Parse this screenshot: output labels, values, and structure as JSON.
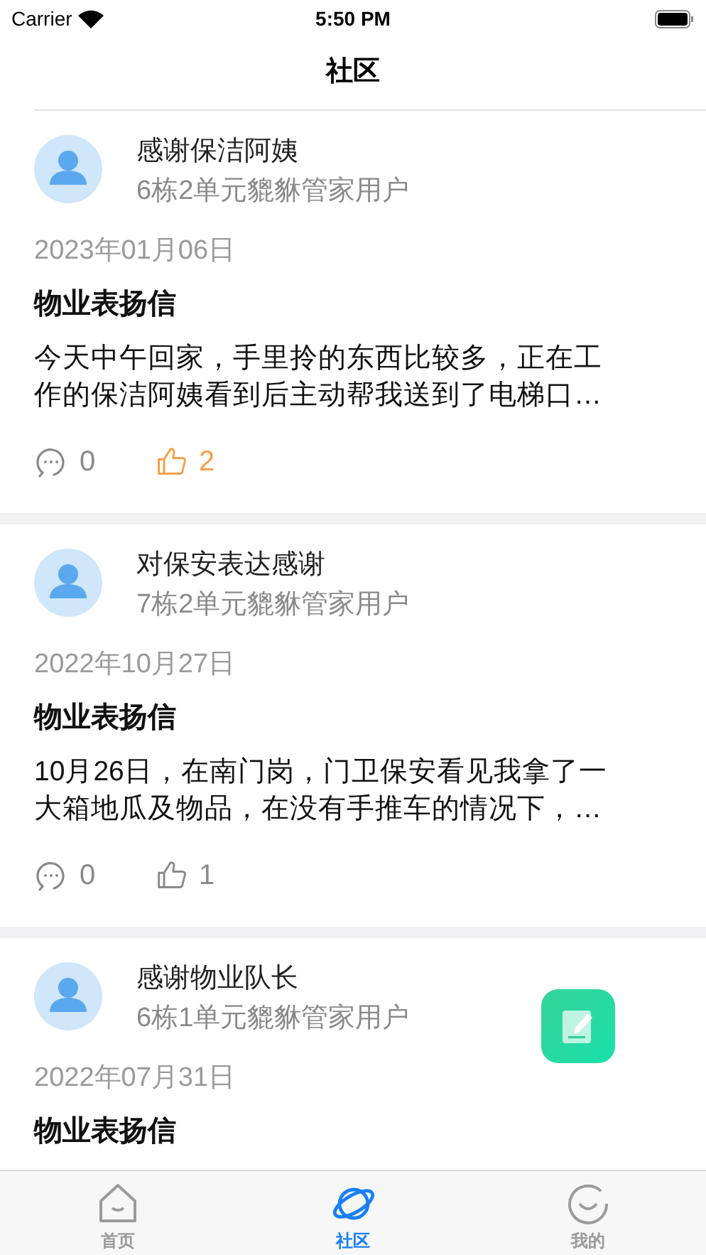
{
  "status_bar": {
    "carrier": "Carrier",
    "time": "5:50 PM"
  },
  "nav": {
    "title": "社区"
  },
  "posts": [
    {
      "title": "感谢保洁阿姨",
      "author": "6栋2单元貔貅管家用户",
      "date": "2023年01月06日",
      "category": "物业表扬信",
      "body": "今天中午回家，手里拎的东西比较多，正在工作的保洁阿姨看到后主动帮我送到了电梯口…",
      "comments": "0",
      "likes": "2",
      "liked": true
    },
    {
      "title": "对保安表达感谢",
      "author": "7栋2单元貔貅管家用户",
      "date": "2022年10月27日",
      "category": "物业表扬信",
      "body": "10月26日，在南门岗，门卫保安看见我拿了一大箱地瓜及物品，在没有手推车的情况下，…",
      "comments": "0",
      "likes": "1",
      "liked": false
    },
    {
      "title": "感谢物业队长",
      "author": "6栋1单元貔貅管家用户",
      "date": "2022年07月31日",
      "category": "物业表扬信"
    }
  ],
  "tabs": [
    {
      "label": "首页",
      "selected": false,
      "kind": "home"
    },
    {
      "label": "社区",
      "selected": true,
      "kind": "planet"
    },
    {
      "label": "我的",
      "selected": false,
      "kind": "smile"
    }
  ]
}
